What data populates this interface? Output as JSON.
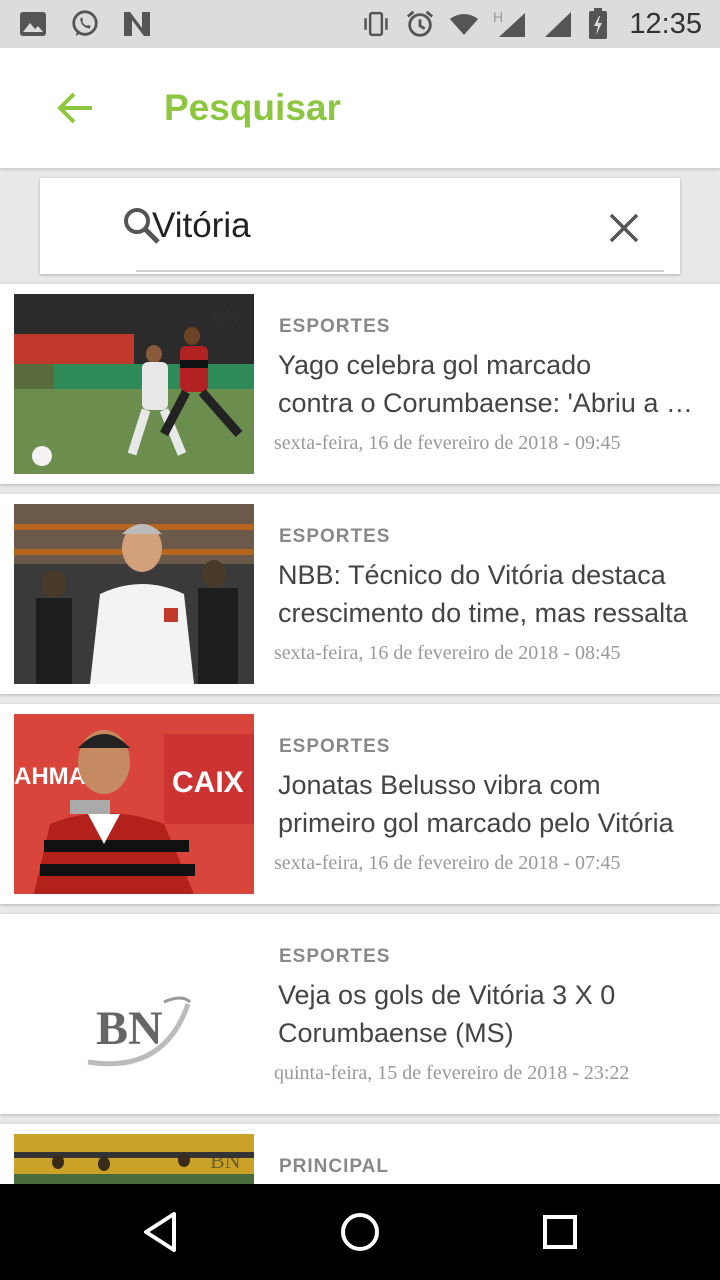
{
  "status_bar": {
    "time": "12:35",
    "left_icons": [
      "image-icon",
      "whatsapp-icon",
      "news-app-icon"
    ],
    "right_icons": [
      "vibrate-icon",
      "alarm-icon",
      "wifi-icon",
      "signal-h-icon",
      "signal-icon",
      "signal-icon",
      "battery-icon"
    ],
    "network_label": "H"
  },
  "app_bar": {
    "title": "Pesquisar",
    "accent_color": "#8dc63f",
    "back_icon": "arrow-left-icon"
  },
  "search": {
    "value": "Vitória",
    "icon": "search-icon",
    "clear_icon": "close-icon"
  },
  "results": [
    {
      "category": "ESPORTES",
      "headline_line1": "Yago celebra gol marcado",
      "headline_line2": "contra o Corumbaense: 'Abriu a porteira'",
      "date": "sexta-feira, 16 de fevereiro de 2018 - 09:45",
      "thumbnail": "soccer-match-photo"
    },
    {
      "category": "ESPORTES",
      "headline_line1": "NBB: Técnico do Vitória destaca",
      "headline_line2": "crescimento do time, mas ressalta",
      "date": "sexta-feira, 16 de fevereiro de 2018 - 08:45",
      "thumbnail": "coach-photo"
    },
    {
      "category": "ESPORTES",
      "headline_line1": " Jonatas Belusso vibra com",
      "headline_line2": "primeiro gol marcado pelo Vitória",
      "date": "sexta-feira, 16 de fevereiro de 2018 - 07:45",
      "thumbnail": "player-press-photo"
    },
    {
      "category": "ESPORTES",
      "headline_line1": "Veja os gols de Vitória 3 X 0",
      "headline_line2": "Corumbaense (MS)",
      "date": "quinta-feira, 15 de fevereiro de 2018 - 23:22",
      "thumbnail": "bn-logo",
      "logo_text": "BN"
    },
    {
      "category": "PRINCIPAL",
      "headline_line1": "",
      "headline_line2": "",
      "date": "",
      "thumbnail": "stadium-photo"
    }
  ],
  "nav_bar": {
    "back": "triangle-back-icon",
    "home": "circle-home-icon",
    "recents": "square-recents-icon"
  }
}
